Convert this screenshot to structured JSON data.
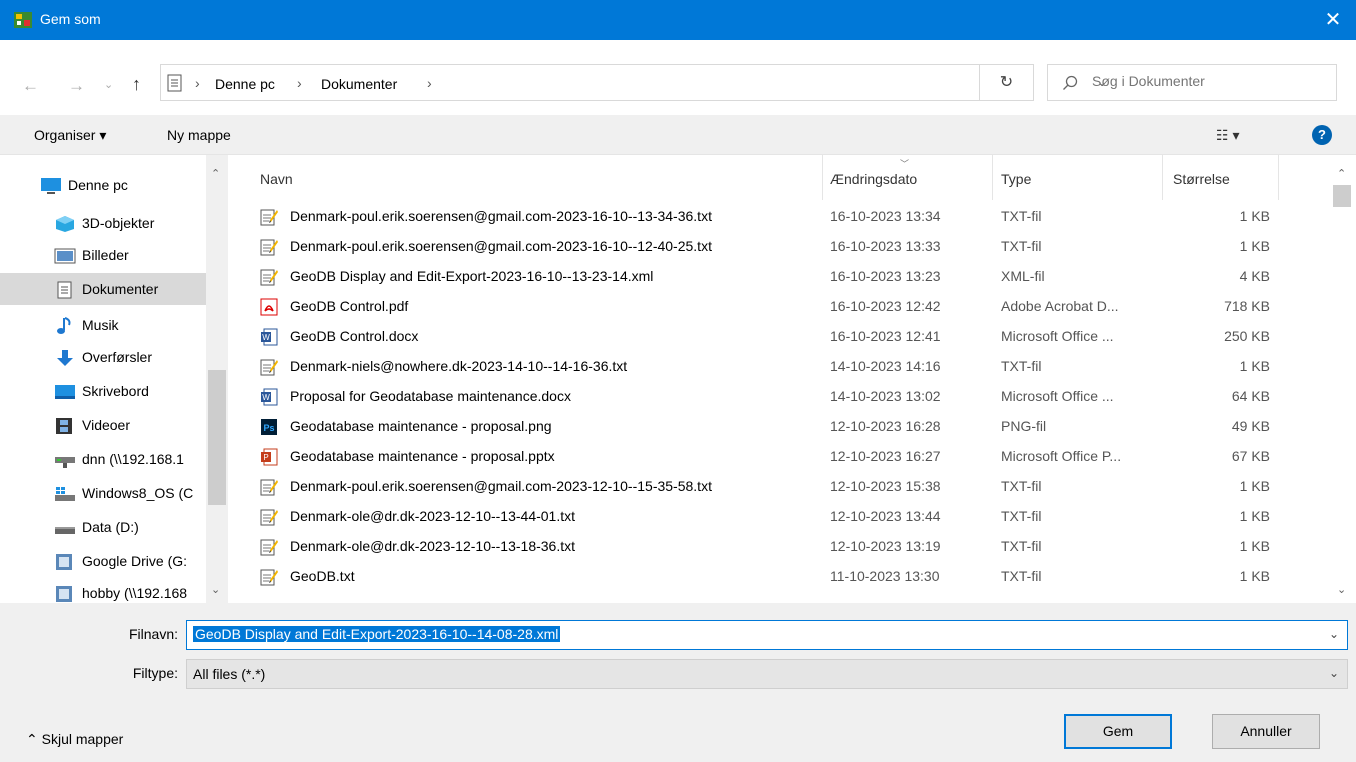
{
  "window": {
    "title": "Gem som"
  },
  "address": {
    "crumbs": [
      "Denne pc",
      "Dokumenter"
    ],
    "search_placeholder": "Søg i Dokumenter"
  },
  "toolbar": {
    "organize_label": "Organiser ▾",
    "new_folder_label": "Ny mappe"
  },
  "sidebar": {
    "items": [
      {
        "label": "Denne pc",
        "icon": "monitor-icon"
      },
      {
        "label": "3D-objekter",
        "icon": "cube-icon"
      },
      {
        "label": "Billeder",
        "icon": "pictures-icon"
      },
      {
        "label": "Dokumenter",
        "icon": "document-icon",
        "selected": true
      },
      {
        "label": "Musik",
        "icon": "music-note-icon"
      },
      {
        "label": "Overførsler",
        "icon": "download-arrow-icon"
      },
      {
        "label": "Skrivebord",
        "icon": "desktop-icon"
      },
      {
        "label": "Videoer",
        "icon": "film-icon"
      },
      {
        "label": "dnn (\\\\192.168.1",
        "icon": "network-drive-icon"
      },
      {
        "label": "Windows8_OS (C",
        "icon": "windows-drive-icon"
      },
      {
        "label": "Data (D:)",
        "icon": "drive-icon"
      },
      {
        "label": "Google Drive (G:",
        "icon": "google-drive-icon"
      },
      {
        "label": "hobby (\\\\192.168",
        "icon": "network-drive-icon"
      }
    ]
  },
  "columns": {
    "name": "Navn",
    "date": "Ændringsdato",
    "type": "Type",
    "size": "Størrelse"
  },
  "files": [
    {
      "name": "Denmark-poul.erik.soerensen@gmail.com-2023-16-10--13-34-36.txt",
      "date": "16-10-2023 13:34",
      "type": "TXT-fil",
      "size": "1 KB",
      "icon": "txt"
    },
    {
      "name": "Denmark-poul.erik.soerensen@gmail.com-2023-16-10--12-40-25.txt",
      "date": "16-10-2023 13:33",
      "type": "TXT-fil",
      "size": "1 KB",
      "icon": "txt"
    },
    {
      "name": "GeoDB Display and Edit-Export-2023-16-10--13-23-14.xml",
      "date": "16-10-2023 13:23",
      "type": "XML-fil",
      "size": "4 KB",
      "icon": "txt"
    },
    {
      "name": "GeoDB Control.pdf",
      "date": "16-10-2023 12:42",
      "type": "Adobe Acrobat D...",
      "size": "718 KB",
      "icon": "pdf"
    },
    {
      "name": "GeoDB Control.docx",
      "date": "16-10-2023 12:41",
      "type": "Microsoft Office ...",
      "size": "250 KB",
      "icon": "word"
    },
    {
      "name": "Denmark-niels@nowhere.dk-2023-14-10--14-16-36.txt",
      "date": "14-10-2023 14:16",
      "type": "TXT-fil",
      "size": "1 KB",
      "icon": "txt"
    },
    {
      "name": "Proposal for Geodatabase maintenance.docx",
      "date": "14-10-2023 13:02",
      "type": "Microsoft Office ...",
      "size": "64 KB",
      "icon": "word"
    },
    {
      "name": "Geodatabase maintenance - proposal.png",
      "date": "12-10-2023 16:28",
      "type": "PNG-fil",
      "size": "49 KB",
      "icon": "ps"
    },
    {
      "name": "Geodatabase maintenance - proposal.pptx",
      "date": "12-10-2023 16:27",
      "type": "Microsoft Office P...",
      "size": "67 KB",
      "icon": "ppt"
    },
    {
      "name": "Denmark-poul.erik.soerensen@gmail.com-2023-12-10--15-35-58.txt",
      "date": "12-10-2023 15:38",
      "type": "TXT-fil",
      "size": "1 KB",
      "icon": "txt"
    },
    {
      "name": "Denmark-ole@dr.dk-2023-12-10--13-44-01.txt",
      "date": "12-10-2023 13:44",
      "type": "TXT-fil",
      "size": "1 KB",
      "icon": "txt"
    },
    {
      "name": "Denmark-ole@dr.dk-2023-12-10--13-18-36.txt",
      "date": "12-10-2023 13:19",
      "type": "TXT-fil",
      "size": "1 KB",
      "icon": "txt"
    },
    {
      "name": "GeoDB.txt",
      "date": "11-10-2023 13:30",
      "type": "TXT-fil",
      "size": "1 KB",
      "icon": "txt"
    }
  ],
  "form": {
    "filename_label": "Filnavn:",
    "filename_value": "GeoDB Display and Edit-Export-2023-16-10--14-08-28.xml",
    "filetype_label": "Filtype:",
    "filetype_value": "All files (*.*)"
  },
  "footer": {
    "hide_folders_label": "Skjul mapper",
    "save_label": "Gem",
    "cancel_label": "Annuller"
  },
  "colors": {
    "titlebar": "#0078d7",
    "selection": "#0078d7",
    "sidebar_selected": "#d9d9d9"
  }
}
